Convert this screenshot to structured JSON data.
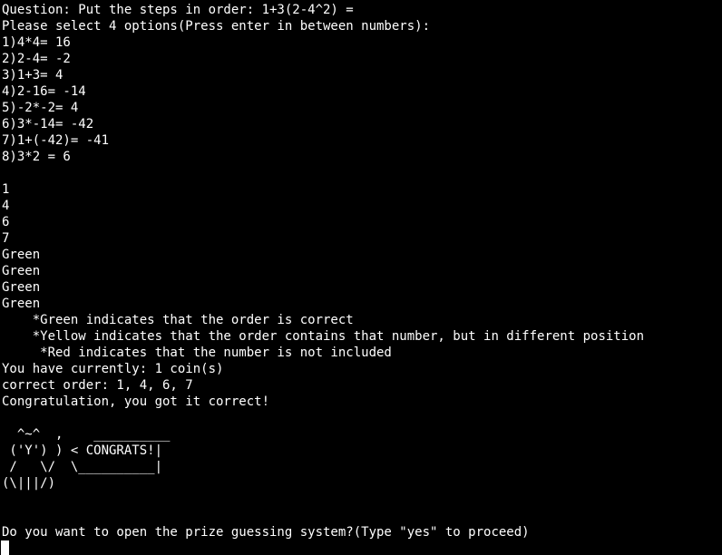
{
  "terminal": {
    "question": "Question: Put the steps in order: 1+3(2-4^2) =",
    "instruction": "Please select 4 options(Press enter in between numbers):",
    "options": [
      "1)4*4= 16",
      "2)2-4= -2",
      "3)1+3= 4",
      "4)2-16= -14",
      "5)-2*-2= 4",
      "6)3*-14= -42",
      "7)1+(-42)= -41",
      "8)3*2 = 6"
    ],
    "inputs": [
      "1",
      "4",
      "6",
      "7"
    ],
    "results": [
      "Green",
      "Green",
      "Green",
      "Green"
    ],
    "legend": {
      "green": "    *Green indicates that the order is correct",
      "yellow": "    *Yellow indicates that the order contains that number, but in different position",
      "red": "     *Red indicates that the number is not included"
    },
    "coins": "You have currently: 1 coin(s)",
    "correct_order": "correct order: 1, 4, 6, 7",
    "congrats_message": "Congratulation, you got it correct!",
    "ascii_art": [
      "  ^~^  ,    __________",
      " ('Y') ) < CONGRATS!|",
      " /   \\/  \\__________|",
      "(\\|||/)"
    ],
    "prompt": "Do you want to open the prize guessing system?(Type \"yes\" to proceed)"
  }
}
